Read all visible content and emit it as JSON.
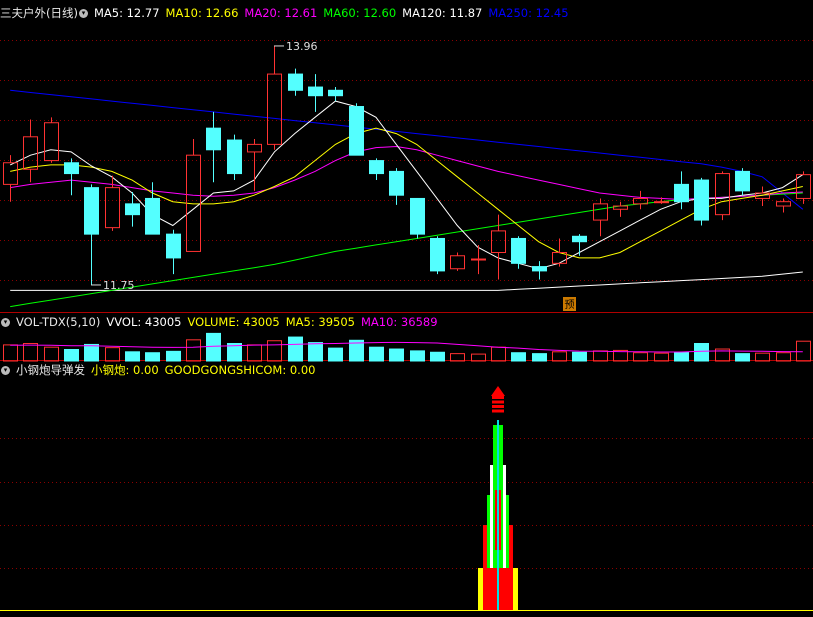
{
  "panels": {
    "price": {
      "stock_name": "三夫户外",
      "period": "(日线)",
      "indicators": [
        {
          "label": "MA5: 12.77",
          "color": "#ffffff"
        },
        {
          "label": "MA10: 12.66",
          "color": "#ffff00"
        },
        {
          "label": "MA20: 12.61",
          "color": "#ff00ff"
        },
        {
          "label": "MA60: 12.60",
          "color": "#00ff00"
        },
        {
          "label": "MA120: 11.87",
          "color": "#ffffff"
        },
        {
          "label": "MA250: 12.45",
          "color": "#0000ff"
        }
      ],
      "high_label": "13.96",
      "low_label": "11.75",
      "badge": "预"
    },
    "volume": {
      "title": "VOL-TDX(5,10)",
      "indicators": [
        {
          "label": "VVOL: 43005",
          "color": "#ffffff"
        },
        {
          "label": "VOLUME: 43005",
          "color": "#ffff00"
        },
        {
          "label": "MA5: 39505",
          "color": "#ffff00"
        },
        {
          "label": "MA10: 36589",
          "color": "#ff00ff"
        }
      ]
    },
    "signal": {
      "title": "小钢炮导弹发",
      "indicators": [
        {
          "label": "小钢炮: 0.00",
          "color": "#ffff00"
        },
        {
          "label": "GOODGONGSHICOM: 0.00",
          "color": "#ffff00"
        }
      ]
    }
  },
  "colors": {
    "up": "#ff3232",
    "down": "#54ffff",
    "grid": "#8b0000",
    "separator": "#b00000",
    "ma5": "#ffffff",
    "ma10": "#ffff00",
    "ma20": "#ff00ff",
    "ma60": "#00ff00",
    "ma120": "#ffffff",
    "ma250": "#0000ff"
  },
  "chart_data": {
    "type": "candlestick",
    "ylim": [
      11.5,
      14.2
    ],
    "candles": [
      {
        "o": 12.68,
        "h": 12.95,
        "l": 12.52,
        "c": 12.88
      },
      {
        "o": 12.82,
        "h": 13.28,
        "l": 12.7,
        "c": 13.12
      },
      {
        "o": 12.9,
        "h": 13.3,
        "l": 12.88,
        "c": 13.25
      },
      {
        "o": 12.88,
        "h": 12.92,
        "l": 12.58,
        "c": 12.78
      },
      {
        "o": 12.65,
        "h": 12.68,
        "l": 11.75,
        "c": 12.22
      },
      {
        "o": 12.28,
        "h": 12.76,
        "l": 12.25,
        "c": 12.65
      },
      {
        "o": 12.5,
        "h": 12.61,
        "l": 12.29,
        "c": 12.4
      },
      {
        "o": 12.55,
        "h": 12.7,
        "l": 12.22,
        "c": 12.22
      },
      {
        "o": 12.22,
        "h": 12.26,
        "l": 11.85,
        "c": 12.0
      },
      {
        "o": 12.06,
        "h": 13.1,
        "l": 12.06,
        "c": 12.95
      },
      {
        "o": 13.2,
        "h": 13.35,
        "l": 12.7,
        "c": 13.0
      },
      {
        "o": 13.09,
        "h": 13.14,
        "l": 12.72,
        "c": 12.78
      },
      {
        "o": 12.98,
        "h": 13.1,
        "l": 12.62,
        "c": 13.05
      },
      {
        "o": 13.05,
        "h": 13.96,
        "l": 13.0,
        "c": 13.7
      },
      {
        "o": 13.7,
        "h": 13.75,
        "l": 13.5,
        "c": 13.55
      },
      {
        "o": 13.58,
        "h": 13.7,
        "l": 13.35,
        "c": 13.5
      },
      {
        "o": 13.55,
        "h": 13.58,
        "l": 13.45,
        "c": 13.5
      },
      {
        "o": 13.4,
        "h": 13.43,
        "l": 12.95,
        "c": 12.95
      },
      {
        "o": 12.9,
        "h": 12.92,
        "l": 12.72,
        "c": 12.78
      },
      {
        "o": 12.8,
        "h": 12.83,
        "l": 12.49,
        "c": 12.58
      },
      {
        "o": 12.55,
        "h": 12.55,
        "l": 12.18,
        "c": 12.22
      },
      {
        "o": 12.18,
        "h": 12.2,
        "l": 11.85,
        "c": 11.88
      },
      {
        "o": 11.9,
        "h": 12.05,
        "l": 11.88,
        "c": 12.02
      },
      {
        "o": 11.99,
        "h": 12.12,
        "l": 11.85,
        "c": 11.99
      },
      {
        "o": 12.05,
        "h": 12.4,
        "l": 11.8,
        "c": 12.25
      },
      {
        "o": 12.18,
        "h": 12.2,
        "l": 11.9,
        "c": 11.95
      },
      {
        "o": 11.92,
        "h": 11.97,
        "l": 11.8,
        "c": 11.88
      },
      {
        "o": 11.95,
        "h": 12.18,
        "l": 11.92,
        "c": 12.05
      },
      {
        "o": 12.2,
        "h": 12.22,
        "l": 12.02,
        "c": 12.15
      },
      {
        "o": 12.35,
        "h": 12.55,
        "l": 12.2,
        "c": 12.5
      },
      {
        "o": 12.45,
        "h": 12.52,
        "l": 12.38,
        "c": 12.48
      },
      {
        "o": 12.5,
        "h": 12.62,
        "l": 12.45,
        "c": 12.55
      },
      {
        "o": 12.52,
        "h": 12.56,
        "l": 12.5,
        "c": 12.52
      },
      {
        "o": 12.68,
        "h": 12.8,
        "l": 12.45,
        "c": 12.52
      },
      {
        "o": 12.72,
        "h": 12.74,
        "l": 12.3,
        "c": 12.35
      },
      {
        "o": 12.4,
        "h": 12.8,
        "l": 12.35,
        "c": 12.78
      },
      {
        "o": 12.8,
        "h": 12.83,
        "l": 12.58,
        "c": 12.62
      },
      {
        "o": 12.55,
        "h": 12.66,
        "l": 12.48,
        "c": 12.6
      },
      {
        "o": 12.48,
        "h": 12.55,
        "l": 12.42,
        "c": 12.52
      },
      {
        "o": 12.55,
        "h": 12.8,
        "l": 12.5,
        "c": 12.77
      }
    ],
    "ma5": [
      12.86,
      12.95,
      13.0,
      12.98,
      12.85,
      12.75,
      12.6,
      12.4,
      12.3,
      12.45,
      12.6,
      12.62,
      12.72,
      12.98,
      13.15,
      13.3,
      13.45,
      13.4,
      13.3,
      13.05,
      12.8,
      12.55,
      12.3,
      12.1,
      12.0,
      11.95,
      11.9,
      11.95,
      12.05,
      12.15,
      12.25,
      12.35,
      12.45,
      12.52,
      12.55,
      12.55,
      12.58,
      12.6,
      12.65,
      12.77
    ],
    "ma10": [
      12.8,
      12.84,
      12.86,
      12.86,
      12.84,
      12.8,
      12.72,
      12.6,
      12.52,
      12.5,
      12.5,
      12.52,
      12.58,
      12.66,
      12.75,
      12.9,
      13.05,
      13.15,
      13.2,
      13.15,
      13.05,
      12.9,
      12.75,
      12.6,
      12.45,
      12.3,
      12.15,
      12.05,
      12.0,
      12.0,
      12.05,
      12.15,
      12.25,
      12.35,
      12.45,
      12.52,
      12.55,
      12.58,
      12.62,
      12.66
    ],
    "ma20": [
      12.65,
      12.68,
      12.7,
      12.72,
      12.7,
      12.68,
      12.65,
      12.62,
      12.6,
      12.58,
      12.57,
      12.58,
      12.6,
      12.65,
      12.72,
      12.8,
      12.9,
      12.98,
      13.02,
      13.03,
      13.0,
      12.95,
      12.9,
      12.85,
      12.8,
      12.76,
      12.72,
      12.68,
      12.64,
      12.6,
      12.58,
      12.56,
      12.55,
      12.54,
      12.55,
      12.56,
      12.57,
      12.58,
      12.6,
      12.61
    ],
    "ma60": [
      11.55,
      11.58,
      11.61,
      11.64,
      11.67,
      11.7,
      11.73,
      11.76,
      11.79,
      11.82,
      11.85,
      11.88,
      11.91,
      11.94,
      11.98,
      12.02,
      12.06,
      12.09,
      12.12,
      12.15,
      12.18,
      12.21,
      12.24,
      12.27,
      12.3,
      12.33,
      12.36,
      12.39,
      12.42,
      12.45,
      12.48,
      12.5,
      12.52,
      12.54,
      12.55,
      12.56,
      12.57,
      12.58,
      12.59,
      12.6
    ],
    "ma120": [
      11.7,
      11.7,
      11.7,
      11.7,
      11.7,
      11.7,
      11.7,
      11.7,
      11.7,
      11.7,
      11.7,
      11.7,
      11.7,
      11.7,
      11.7,
      11.7,
      11.7,
      11.7,
      11.7,
      11.7,
      11.7,
      11.7,
      11.7,
      11.7,
      11.7,
      11.71,
      11.72,
      11.73,
      11.74,
      11.75,
      11.76,
      11.77,
      11.78,
      11.79,
      11.8,
      11.81,
      11.82,
      11.83,
      11.85,
      11.87
    ],
    "ma250": [
      13.55,
      13.53,
      13.51,
      13.49,
      13.47,
      13.45,
      13.43,
      13.41,
      13.39,
      13.37,
      13.35,
      13.33,
      13.31,
      13.29,
      13.27,
      13.25,
      13.23,
      13.21,
      13.19,
      13.17,
      13.15,
      13.13,
      13.11,
      13.09,
      13.07,
      13.05,
      13.03,
      13.01,
      12.99,
      12.97,
      12.95,
      12.93,
      12.91,
      12.89,
      12.87,
      12.84,
      12.8,
      12.75,
      12.6,
      12.45
    ],
    "volume": [
      35000,
      38000,
      30000,
      25000,
      36000,
      29000,
      20000,
      18000,
      21000,
      46000,
      60000,
      38000,
      35000,
      44000,
      52000,
      40000,
      28000,
      45000,
      30000,
      26000,
      22000,
      19000,
      16000,
      15000,
      30000,
      18000,
      16000,
      20000,
      19000,
      22000,
      23000,
      18000,
      17000,
      19000,
      38000,
      26000,
      16000,
      17000,
      18000,
      43005
    ],
    "volume_ma10": [
      34000,
      34500,
      34000,
      33000,
      33000,
      32000,
      31000,
      30000,
      29500,
      30000,
      32000,
      33000,
      34500,
      35000,
      36000,
      37500,
      38000,
      39000,
      40000,
      40500,
      40000,
      39000,
      36000,
      33000,
      30000,
      28000,
      25000,
      23000,
      21500,
      21000,
      20500,
      20000,
      19500,
      19500,
      21000,
      22000,
      21500,
      21000,
      20500,
      20000
    ],
    "signal_bar_index": 24,
    "signal_value": 0.0
  }
}
